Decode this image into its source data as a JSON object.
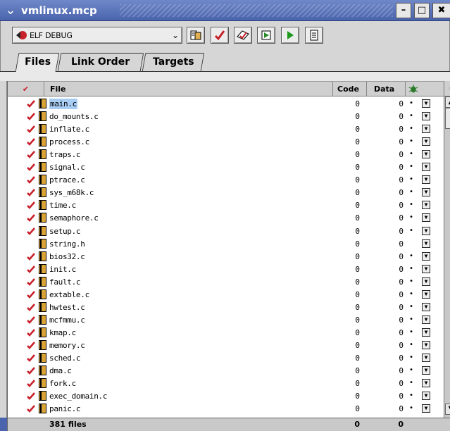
{
  "window": {
    "title": "vmlinux.mcp",
    "minimize_label": "–",
    "maximize_label": "□",
    "close_label": "✖"
  },
  "toolbar": {
    "target_name": "ELF DEBUG",
    "target_arrow": "⌄"
  },
  "tabs": [
    {
      "label": "Files",
      "active": true
    },
    {
      "label": "Link Order",
      "active": false
    },
    {
      "label": "Targets",
      "active": false
    }
  ],
  "columns": {
    "check": "✔",
    "file": "File",
    "code": "Code",
    "data": "Data"
  },
  "files": [
    {
      "name": "main.c",
      "checked": true,
      "code": "0",
      "data": "0",
      "dot": "•",
      "selected": true
    },
    {
      "name": "do_mounts.c",
      "checked": true,
      "code": "0",
      "data": "0",
      "dot": "•"
    },
    {
      "name": "inflate.c",
      "checked": true,
      "code": "0",
      "data": "0",
      "dot": "•"
    },
    {
      "name": "process.c",
      "checked": true,
      "code": "0",
      "data": "0",
      "dot": "•"
    },
    {
      "name": "traps.c",
      "checked": true,
      "code": "0",
      "data": "0",
      "dot": "•"
    },
    {
      "name": "signal.c",
      "checked": true,
      "code": "0",
      "data": "0",
      "dot": "•"
    },
    {
      "name": "ptrace.c",
      "checked": true,
      "code": "0",
      "data": "0",
      "dot": "•"
    },
    {
      "name": "sys_m68k.c",
      "checked": true,
      "code": "0",
      "data": "0",
      "dot": "•"
    },
    {
      "name": "time.c",
      "checked": true,
      "code": "0",
      "data": "0",
      "dot": "•"
    },
    {
      "name": "semaphore.c",
      "checked": true,
      "code": "0",
      "data": "0",
      "dot": "•"
    },
    {
      "name": "setup.c",
      "checked": true,
      "code": "0",
      "data": "0",
      "dot": "•"
    },
    {
      "name": "string.h",
      "checked": false,
      "code": "0",
      "data": "0",
      "dot": ""
    },
    {
      "name": "bios32.c",
      "checked": true,
      "code": "0",
      "data": "0",
      "dot": "•"
    },
    {
      "name": "init.c",
      "checked": true,
      "code": "0",
      "data": "0",
      "dot": "•"
    },
    {
      "name": "fault.c",
      "checked": true,
      "code": "0",
      "data": "0",
      "dot": "•"
    },
    {
      "name": "extable.c",
      "checked": true,
      "code": "0",
      "data": "0",
      "dot": "•"
    },
    {
      "name": "hwtest.c",
      "checked": true,
      "code": "0",
      "data": "0",
      "dot": "•"
    },
    {
      "name": "mcfmmu.c",
      "checked": true,
      "code": "0",
      "data": "0",
      "dot": "•"
    },
    {
      "name": "kmap.c",
      "checked": true,
      "code": "0",
      "data": "0",
      "dot": "•"
    },
    {
      "name": "memory.c",
      "checked": true,
      "code": "0",
      "data": "0",
      "dot": "•"
    },
    {
      "name": "sched.c",
      "checked": true,
      "code": "0",
      "data": "0",
      "dot": "•"
    },
    {
      "name": "dma.c",
      "checked": true,
      "code": "0",
      "data": "0",
      "dot": "•"
    },
    {
      "name": "fork.c",
      "checked": true,
      "code": "0",
      "data": "0",
      "dot": "•"
    },
    {
      "name": "exec_domain.c",
      "checked": true,
      "code": "0",
      "data": "0",
      "dot": "•"
    },
    {
      "name": "panic.c",
      "checked": true,
      "code": "0",
      "data": "0",
      "dot": "•"
    }
  ],
  "footer": {
    "file_count": "381 files",
    "code_total": "0",
    "data_total": "0"
  },
  "colors": {
    "titlebar": "#4a64ad",
    "check_red": "#c8202a",
    "selection": "#a9cdf3"
  }
}
